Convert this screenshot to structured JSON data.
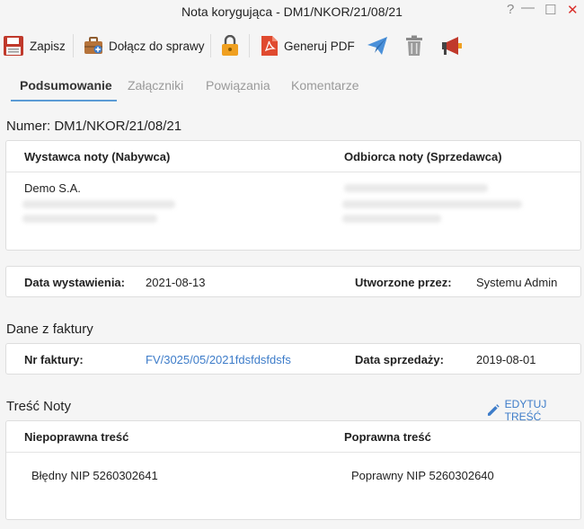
{
  "window": {
    "title": "Nota korygująca - DM1/NKOR/21/08/21",
    "help": "?",
    "minimize": "—",
    "maximize": "☐",
    "close": "✕"
  },
  "toolbar": {
    "save": "Zapisz",
    "attach": "Dołącz do sprawy",
    "pdf": "Generuj PDF"
  },
  "tabs": [
    "Podsumowanie",
    "Załączniki",
    "Powiązania",
    "Komentarze"
  ],
  "number": "Numer: DM1/NKOR/21/08/21",
  "parties": {
    "issuer_label": "Wystawca noty (Nabywca)",
    "recipient_label": "Odbiorca noty (Sprzedawca)",
    "issuer_name": "Demo S.A."
  },
  "info": {
    "issue_date_label": "Data wystawienia:",
    "issue_date": "2021-08-13",
    "created_by_label": "Utworzone przez:",
    "created_by": "Systemu Admin"
  },
  "invoice": {
    "section_title": "Dane z faktury",
    "number_label": "Nr faktury:",
    "number": "FV/3025/05/2021fdsfdsfdsfs",
    "sale_date_label": "Data sprzedaży:",
    "sale_date": "2019-08-01"
  },
  "note_content": {
    "section_title": "Treść Noty",
    "edit": "EDYTUJ TREŚĆ",
    "incorrect_label": "Niepoprawna treść",
    "correct_label": "Poprawna treść",
    "incorrect": "Błędny NIP 5260302641",
    "correct": "Poprawny NIP 5260302640"
  },
  "colors": {
    "accent": "#3d7cc9",
    "tab_underline": "#5b9bd5",
    "close": "#d9302c",
    "lock": "#f0a020",
    "pdf": "#e04a2f",
    "save": "#c0392b"
  }
}
